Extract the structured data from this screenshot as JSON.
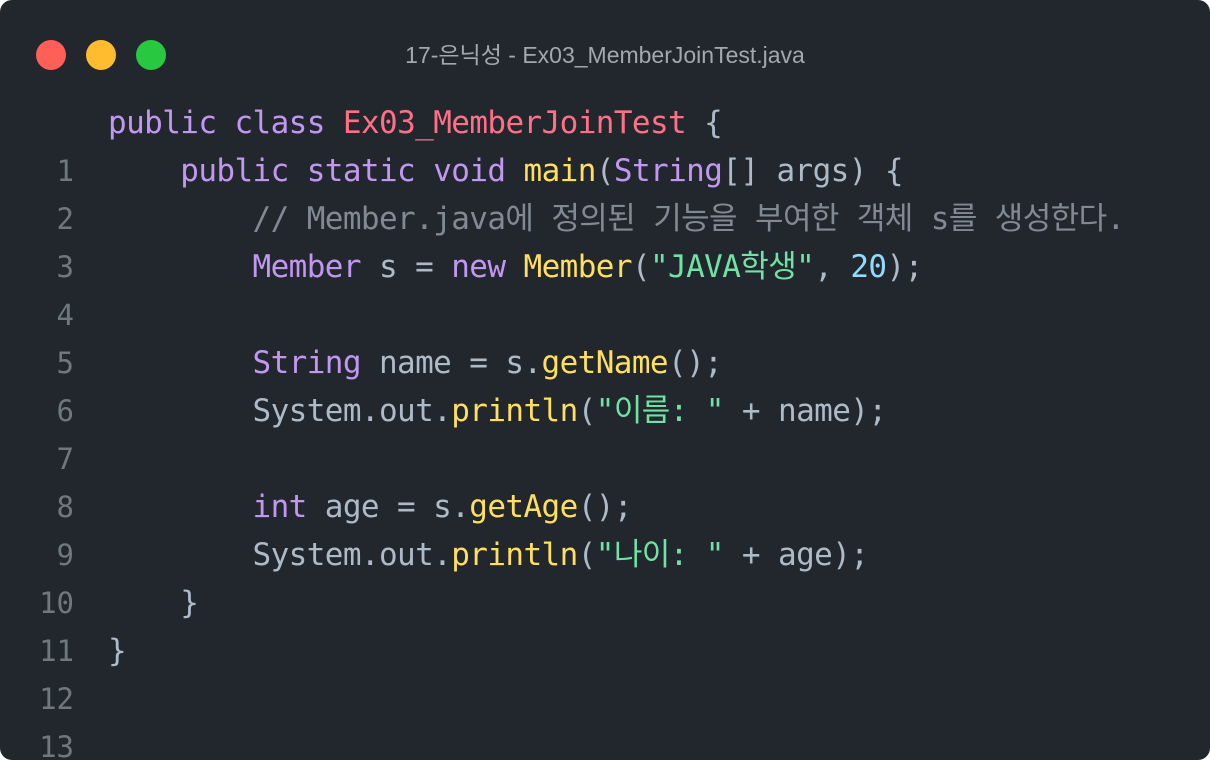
{
  "window": {
    "title": "17-은닉성 - Ex03_MemberJoinTest.java"
  },
  "colors": {
    "background": "#22272e",
    "keyword": "#c297f1",
    "class_name": "#ff7087",
    "function": "#ffdf5e",
    "string": "#6ee3a3",
    "number": "#8fdcfb",
    "comment": "#818a94",
    "plain": "#adbac7",
    "line_number": "#6f777f",
    "close_button": "#ff5f57",
    "minimize_button": "#febc2e",
    "zoom_button": "#28c840"
  },
  "code": {
    "line_numbers": [
      "1",
      "2",
      "3",
      "4",
      "5",
      "6",
      "7",
      "8",
      "9",
      "10",
      "11",
      "12",
      "13"
    ],
    "l1": {
      "kw1": "public",
      "kw2": "class",
      "cls": "Ex03_MemberJoinTest",
      "p1": " {"
    },
    "l2": {
      "indent": "    ",
      "kw1": "public",
      "kw2": "static",
      "kw3": "void",
      "fn": "main",
      "p1": "(",
      "kw4": "String",
      "p2": "[] args) {"
    },
    "l3": {
      "indent": "        ",
      "comment": "// Member.java에 정의된 기능을 부여한 객체 s를 생성한다."
    },
    "l4": {
      "indent": "        ",
      "kw1": "Member",
      "p1": " s = ",
      "kw2": "new",
      "fn": "Member",
      "p2": "(",
      "str": "\"JAVA학생\"",
      "p3": ", ",
      "num": "20",
      "p4": ");"
    },
    "l6": {
      "indent": "        ",
      "kw1": "String",
      "p1": " name = s.",
      "fn": "getName",
      "p2": "();"
    },
    "l7": {
      "indent": "        ",
      "p1": "System.out.",
      "fn": "println",
      "p2": "(",
      "str": "\"이름: \"",
      "p3": " + name);"
    },
    "l9": {
      "indent": "        ",
      "kw1": "int",
      "p1": " age = s.",
      "fn": "getAge",
      "p2": "();"
    },
    "l10": {
      "indent": "        ",
      "p1": "System.out.",
      "fn": "println",
      "p2": "(",
      "str": "\"나이: \"",
      "p3": " + age);"
    },
    "l11": {
      "text": "    }"
    },
    "l12": {
      "text": "}"
    }
  }
}
